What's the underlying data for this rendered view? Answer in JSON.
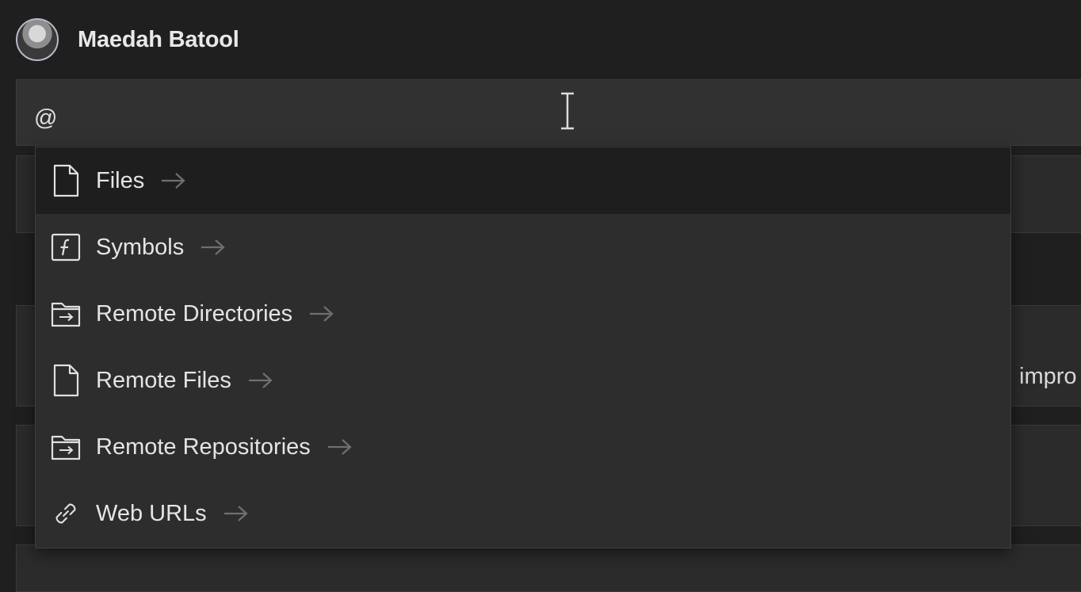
{
  "user": {
    "name": "Maedah Batool"
  },
  "chat_input": {
    "value": "@"
  },
  "background_card": {
    "partial_text": "impro"
  },
  "context_menu": {
    "items": [
      {
        "label": "Files",
        "icon": "file-icon",
        "active": true
      },
      {
        "label": "Symbols",
        "icon": "function-symbol-icon",
        "active": false
      },
      {
        "label": "Remote Directories",
        "icon": "remote-folder-icon",
        "active": false
      },
      {
        "label": "Remote Files",
        "icon": "file-icon",
        "active": false
      },
      {
        "label": "Remote Repositories",
        "icon": "remote-folder-icon",
        "active": false
      },
      {
        "label": "Web URLs",
        "icon": "link-icon",
        "active": false
      }
    ]
  },
  "colors": {
    "background": "#1f1f1f",
    "input_background": "#313131",
    "menu_background": "#2d2d2d",
    "menu_active": "#1e1e1e",
    "text": "#e4e4e4",
    "arrow": "#7a7a7a"
  }
}
